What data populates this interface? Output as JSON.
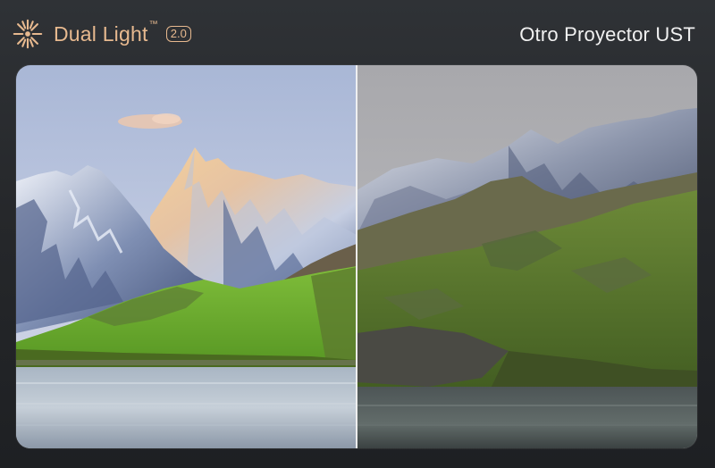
{
  "header": {
    "brand_name": "Dual Light",
    "brand_tm": "™",
    "brand_version": "2.0",
    "brand_icon": "sun-burst-icon",
    "compare_label": "Otro Proyector UST"
  },
  "colors": {
    "brand_accent": "#e7b98f",
    "background": "#2a2c2f",
    "divider": "#f2f2f2"
  }
}
